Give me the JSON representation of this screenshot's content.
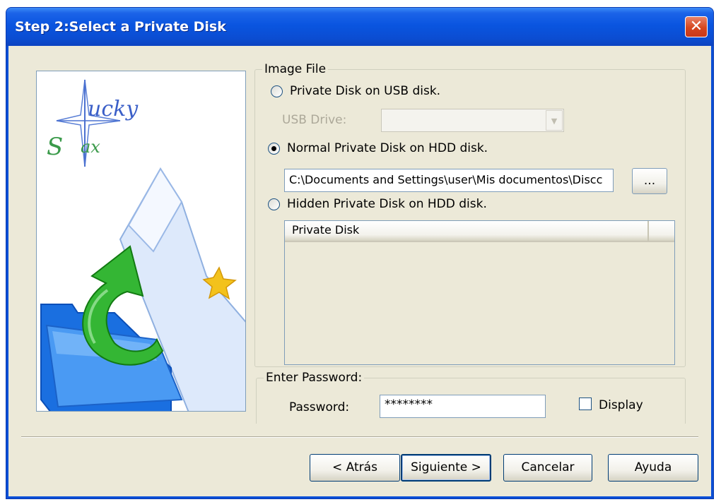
{
  "window": {
    "title": "Step 2:Select a Private Disk"
  },
  "logo": {
    "line1": "ucky",
    "line2": "ax"
  },
  "image_file": {
    "legend": "Image File",
    "usb_option": "Private Disk on USB disk.",
    "usb_drive_label": "USB Drive:",
    "usb_drive_value": "",
    "hdd_option": "Normal Private Disk on HDD disk.",
    "path_value": "C:\\Documents and Settings\\user\\Mis documentos\\Discc",
    "browse_label": "...",
    "hidden_option": "Hidden Private Disk on HDD disk.",
    "list_header": "Private Disk"
  },
  "password": {
    "legend": "Enter Password:",
    "label": "Password:",
    "value": "********",
    "display_label": "Display"
  },
  "buttons": {
    "back": "< Atrás",
    "next": "Siguiente >",
    "cancel": "Cancelar",
    "help": "Ayuda"
  }
}
